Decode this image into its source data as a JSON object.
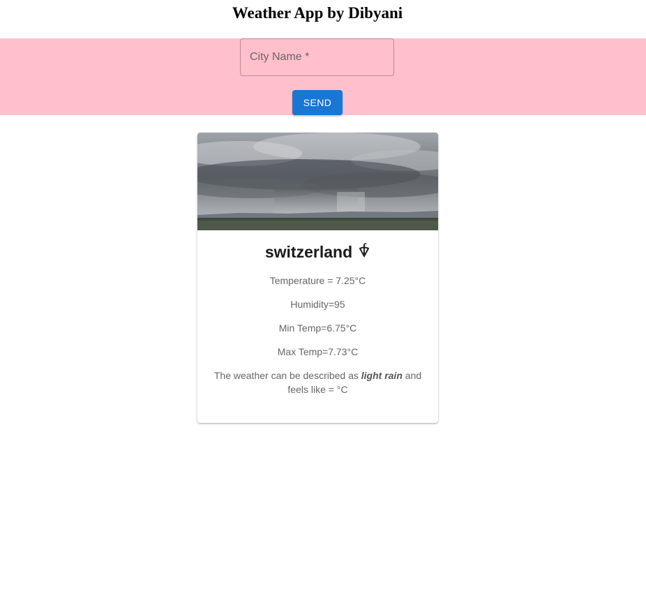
{
  "app": {
    "title": "Weather App by Dibyani"
  },
  "search": {
    "city_label": "City Name *",
    "send_label": "SEND"
  },
  "card": {
    "city": "switzerland",
    "weather_icon": "umbrella-icon",
    "temperature": "Temperature = 7.25°C",
    "humidity": "Humidity=95",
    "min_temp": "Min Temp=6.75°C",
    "max_temp": "Max Temp=7.73°C",
    "description_prefix": "The weather can be described as ",
    "description_value": "light rain",
    "description_suffix": " and feels like = °C"
  },
  "colors": {
    "band": "#ffc0cb",
    "button": "#1976d2"
  }
}
